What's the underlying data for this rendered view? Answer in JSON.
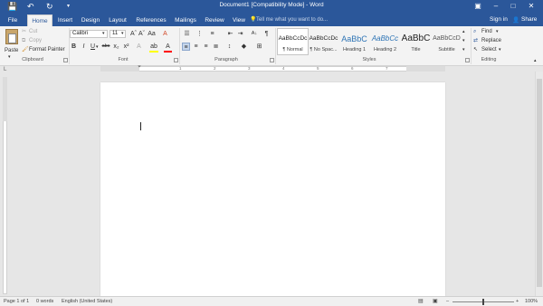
{
  "window": {
    "title": "Document1 [Compatibility Mode] - Word",
    "minimize": "–",
    "maximize": "□",
    "close": "✕",
    "ribbon_display": "▣"
  },
  "quick_access": {
    "save": "💾",
    "undo": "↶",
    "redo": "↻",
    "customize": "▾"
  },
  "tabs": [
    {
      "label": "File"
    },
    {
      "label": "Home"
    },
    {
      "label": "Insert"
    },
    {
      "label": "Design"
    },
    {
      "label": "Layout"
    },
    {
      "label": "References"
    },
    {
      "label": "Mailings"
    },
    {
      "label": "Review"
    },
    {
      "label": "View"
    }
  ],
  "active_tab": "Home",
  "tell_me": "Tell me what you want to do...",
  "account": {
    "sign_in": "Sign in",
    "share": "Share"
  },
  "clipboard": {
    "label": "Clipboard",
    "paste": "Paste",
    "cut": "Cut",
    "copy": "Copy",
    "format_painter": "Format Painter"
  },
  "font": {
    "label": "Font",
    "name": "Calibri",
    "size": "11",
    "bold": "B",
    "italic": "I",
    "underline": "U",
    "grow": "Aˆ",
    "shrink": "Aˇ",
    "case": "Aa",
    "clear": "A",
    "strike": "abc",
    "sub": "x₂",
    "sup": "x²",
    "effects": "A",
    "highlight": "ab",
    "color": "A"
  },
  "paragraph": {
    "label": "Paragraph",
    "pilcrow": "¶",
    "sort": "A↓"
  },
  "styles": {
    "label": "Styles",
    "items": [
      {
        "preview": "AaBbCcDc",
        "name": "¶ Normal"
      },
      {
        "preview": "AaBbCcDc",
        "name": "¶ No Spac..."
      },
      {
        "preview": "AaBbC",
        "name": "Heading 1"
      },
      {
        "preview": "AaBbCc",
        "name": "Heading 2"
      },
      {
        "preview": "AaBbC",
        "name": "Title"
      },
      {
        "preview": "AaBbCcD",
        "name": "Subtitle"
      }
    ]
  },
  "editing": {
    "label": "Editing",
    "find": "Find",
    "replace": "Replace",
    "select": "Select"
  },
  "ruler": {
    "marks": [
      "2",
      "1",
      "1",
      "2",
      "3",
      "4",
      "5",
      "6",
      "7"
    ]
  },
  "status": {
    "page": "Page 1 of 1",
    "words": "0 words",
    "language": "English (United States)",
    "zoom": "100%",
    "zoom_minus": "–",
    "zoom_plus": "+",
    "zoom_level": 0.5
  },
  "colors": {
    "accent": "#2b579a",
    "highlight": "#ffff00",
    "font_color": "#ff0000"
  }
}
